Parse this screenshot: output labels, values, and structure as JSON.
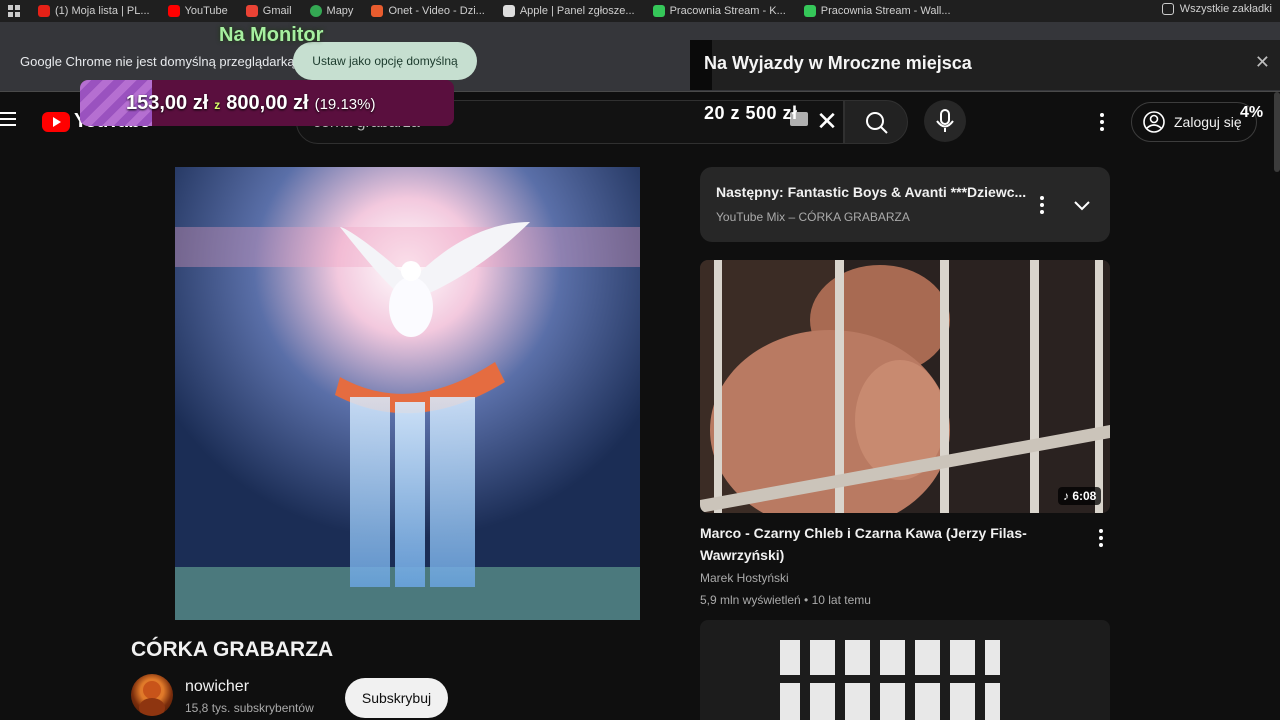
{
  "bookmarks": [
    {
      "label": "(1) Moja lista | PL...",
      "color": "#e62117"
    },
    {
      "label": "YouTube",
      "color": "#ff0000"
    },
    {
      "label": "Gmail",
      "color": "#ea4335"
    },
    {
      "label": "Mapy",
      "color": "#34a853"
    },
    {
      "label": "Onet - Video - Dzi...",
      "color": "#e85c2e"
    },
    {
      "label": "Apple | Panel zgłosze...",
      "color": "#dddddd"
    },
    {
      "label": "Pracownia Stream - K...",
      "color": "#35c759"
    },
    {
      "label": "Pracownia Stream - Wall...",
      "color": "#35c759"
    }
  ],
  "bookmarks_right": "Wszystkie zakładki",
  "infobar": {
    "message": "Google Chrome nie jest domyślną przeglądarką",
    "button": "Ustaw jako opcję domyślną"
  },
  "overlay": {
    "na_monitor": "Na Monitor",
    "goal_current": "153,00 zł",
    "goal_sep": "z",
    "goal_target": "800,00 zł",
    "goal_percent": "(19.13%)",
    "goal_fraction": 0.1913,
    "alert_text": "Na Wyjazdy w Mroczne miejsca",
    "alert_close": "✕",
    "counter": "20 z 500 zł",
    "percent_right": "4%"
  },
  "masthead": {
    "logo": "YouTube",
    "search_value": "córka grabarza",
    "clear": "✕",
    "signin": "Zaloguj się"
  },
  "video": {
    "title": "CÓRKA GRABARZA",
    "channel": "nowicher",
    "subscribers": "15,8 tys. subskrybentów",
    "subscribe": "Subskrybuj"
  },
  "up_next": {
    "title": "Następny: Fantastic Boys & Avanti ***Dziewc...",
    "subtitle": "YouTube Mix – CÓRKA GRABARZA"
  },
  "sidebar_video": {
    "duration": "♪ 6:08",
    "title": "Marco  - Czarny Chleb i Czarna Kawa (Jerzy Filas-Wawrzyński)",
    "channel": "Marek Hostyński",
    "meta": "5,9 mln wyświetleń • 10 lat temu"
  },
  "colors": {
    "youtube_red": "#ff0000",
    "goal_bg": "#5a0f3e",
    "goal_fill": "#b56fd1",
    "infobar_btn": "#c6dfd0"
  }
}
